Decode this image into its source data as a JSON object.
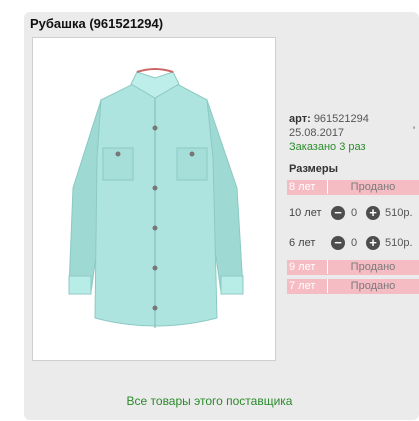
{
  "product": {
    "title": "Рубашка (961521294)",
    "art_label": "арт:",
    "art_value": "961521294",
    "date": "25.08.2017",
    "ordered": "Заказано 3 раз",
    "tick": "'"
  },
  "sizes": {
    "heading": "Размеры",
    "rows": [
      {
        "size": "8 лет",
        "status": "Продано"
      },
      {
        "size": "10 лет",
        "minus": "−",
        "qty": "0",
        "plus": "+",
        "price": "510р."
      },
      {
        "size": "6 лет",
        "minus": "−",
        "qty": "0",
        "plus": "+",
        "price": "510р."
      },
      {
        "size": "9 лет",
        "status": "Продано"
      },
      {
        "size": "7 лет",
        "status": "Продано"
      }
    ]
  },
  "footer": {
    "supplier_link": "Все товары этого поставщика"
  },
  "colors": {
    "card": "#ebebeb",
    "sold_row": "#f6bcc4",
    "link": "#2a8a2a",
    "shirt": "#aee4df"
  }
}
